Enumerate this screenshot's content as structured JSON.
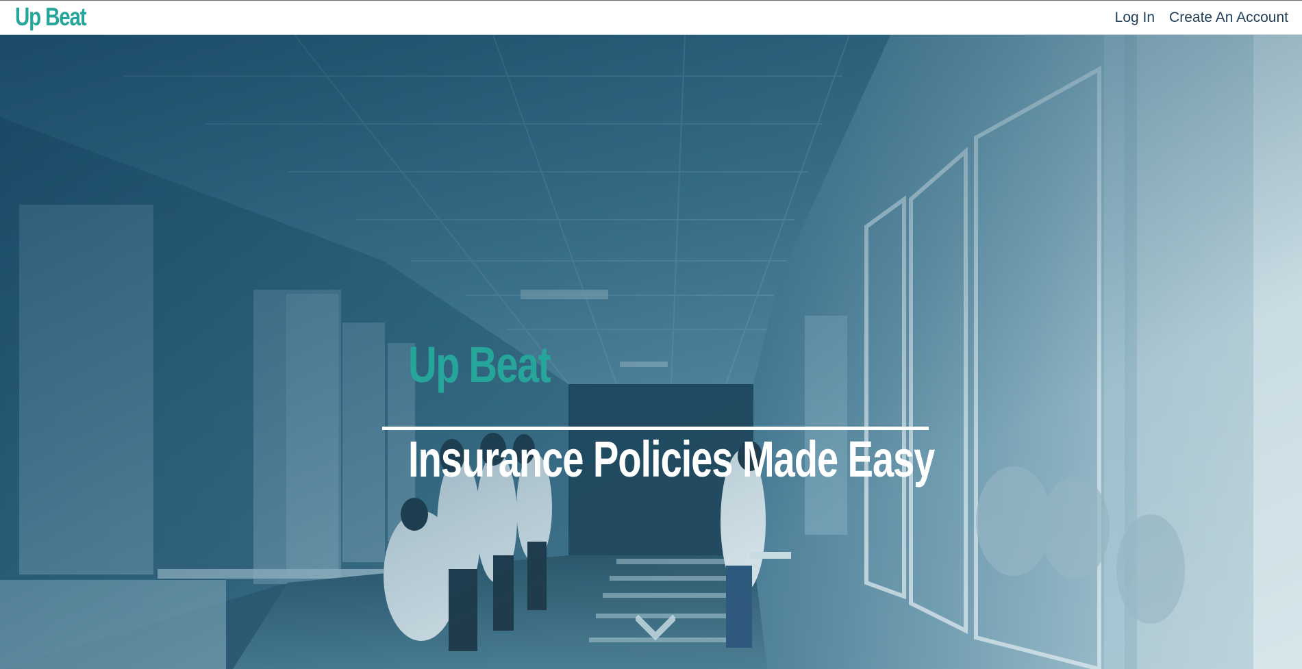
{
  "header": {
    "brand": "Up Beat",
    "nav": [
      {
        "label": "Log In"
      },
      {
        "label": "Create An Account"
      }
    ]
  },
  "hero": {
    "title": "Up Beat",
    "tagline": "Insurance Policies Made Easy",
    "background_image": "hospital-corridor-photo",
    "scroll_icon": "chevron-down-icon"
  },
  "colors": {
    "brand": "#26a69a",
    "nav_text": "#1f3d57",
    "overlay": "#0c3c5c",
    "tagline": "#ffffff"
  }
}
